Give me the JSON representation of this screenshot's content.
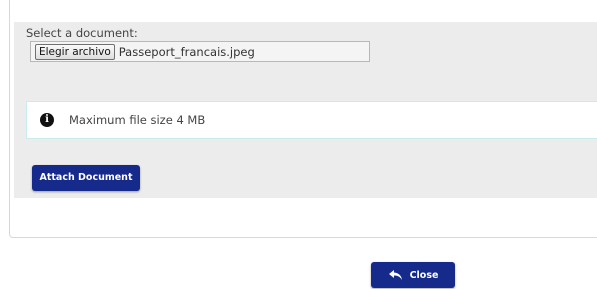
{
  "form": {
    "select_label": "Select a document:",
    "choose_button_label": "Elegir archivo",
    "selected_file_name": "Passeport_francais.jpeg",
    "info_message": "Maximum file size 4 MB",
    "info_icon": "info-circle-icon",
    "attach_button_label": "Attach Document"
  },
  "footer": {
    "close_button_label": "Close",
    "close_icon": "undo-arrow-icon"
  },
  "colors": {
    "primary_button": "#162a8c",
    "form_background": "#ececec",
    "info_border": "#c9ecec"
  }
}
